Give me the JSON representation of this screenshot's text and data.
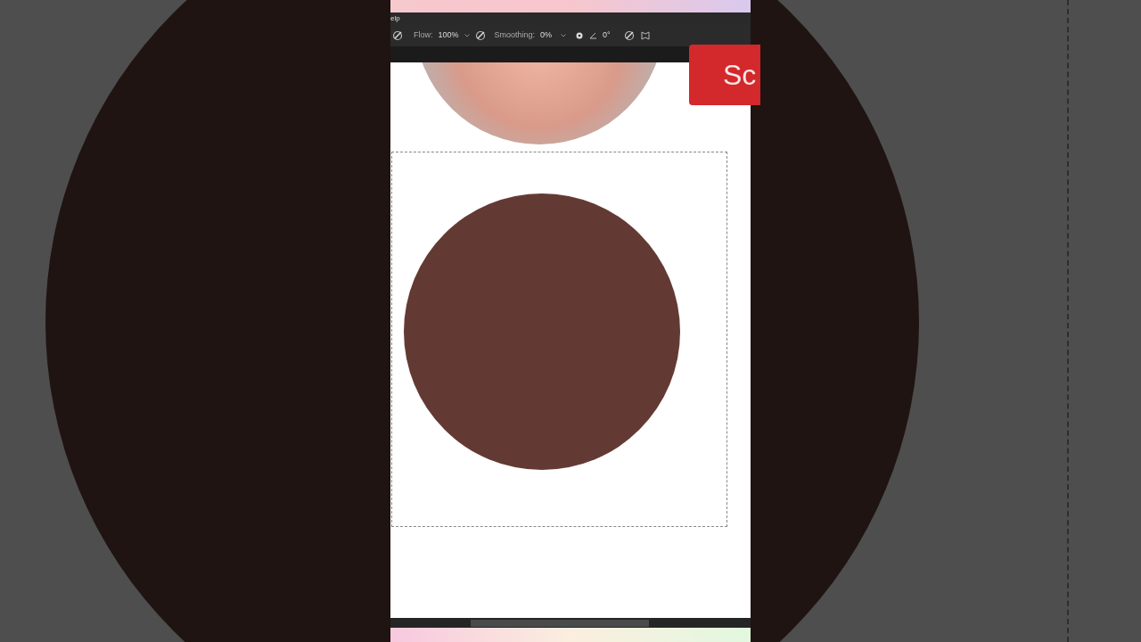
{
  "menu_bar": {
    "items": [
      "elp"
    ]
  },
  "options_bar": {
    "flow_label": "Flow:",
    "flow_value": "100%",
    "smoothing_label": "Smoothing:",
    "smoothing_value": "0%",
    "angle_value": "0°"
  },
  "overlay_label": {
    "text": "Sc"
  }
}
